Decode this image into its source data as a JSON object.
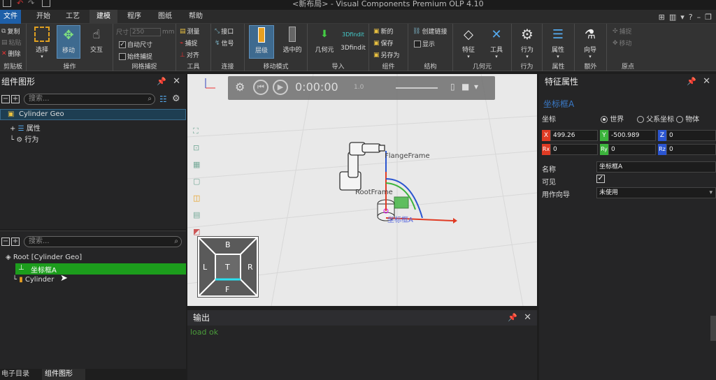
{
  "window": {
    "title": "<新布局> - Visual Components Premium OLP 4.10"
  },
  "menu": {
    "tabs": [
      {
        "label": "文件"
      },
      {
        "label": "开始"
      },
      {
        "label": "工艺"
      },
      {
        "label": "建模"
      },
      {
        "label": "程序"
      },
      {
        "label": "图纸"
      },
      {
        "label": "帮助"
      }
    ],
    "active_tab": "建模"
  },
  "ribbon": {
    "clipboard": {
      "label": "剪贴板",
      "copy": "复制",
      "paste": "粘贴",
      "delete": "删除"
    },
    "operation": {
      "label": "操作",
      "select": "选择",
      "move": "移动",
      "interact": "交互"
    },
    "grid_snap": {
      "label": "网格捕捉",
      "size_label": "尺寸",
      "size_value": "250",
      "size_unit": "mm",
      "auto_size": "自动尺寸",
      "always_snap": "始终捕捉"
    },
    "tools": {
      "label": "工具",
      "measure": "测量",
      "snap": "捕捉",
      "align": "对齐"
    },
    "connect": {
      "label": "连接",
      "interface": "接口",
      "signal": "信号"
    },
    "move_mode": {
      "label": "移动模式",
      "hierarchy": "层级",
      "selected": "选中的"
    },
    "import": {
      "label": "导入",
      "geometry": "几何元",
      "findit": "3Dfindit",
      "findit_logo": "3Dfindit"
    },
    "component": {
      "label": "组件",
      "new": "新的",
      "save": "保存",
      "save_as": "另存为"
    },
    "structure": {
      "label": "结构",
      "create_link": "创建链接",
      "show": "显示"
    },
    "geometry": {
      "label": "几何元",
      "feature": "特征",
      "tools": "工具"
    },
    "behavior": {
      "label": "行为",
      "behavior": "行为"
    },
    "properties": {
      "label": "属性",
      "properties": "属性"
    },
    "extra": {
      "label": "额外",
      "wizard": "向导"
    },
    "origin": {
      "label": "原点",
      "snap": "捕捉",
      "move": "移动"
    }
  },
  "component_graph": {
    "title": "组件图形",
    "search_placeholder": "搜索...",
    "root": "Cylinder Geo",
    "children": [
      {
        "label": "属性"
      },
      {
        "label": "行为"
      }
    ]
  },
  "feature_tree": {
    "search_placeholder": "搜索...",
    "root": "Root [Cylinder Geo]",
    "items": [
      {
        "label": "坐标框A",
        "selected": true
      },
      {
        "label": "Cylinder",
        "selected": false
      }
    ]
  },
  "viewport": {
    "time": "0:00:00",
    "speed": "1.0",
    "labels": {
      "flange": "FlangeFrame",
      "root": "RootFrame",
      "frame_a": "坐标框A"
    },
    "navcube": {
      "top": "B",
      "left": "L",
      "center": "T",
      "right": "R",
      "bottom": "F"
    }
  },
  "output": {
    "title": "输出",
    "lines": [
      "load ok"
    ]
  },
  "properties_panel": {
    "title": "特征属性",
    "subtitle": "坐标框A",
    "coord_label": "坐标",
    "coord_options": [
      {
        "label": "世界",
        "selected": true
      },
      {
        "label": "父系坐标",
        "selected": false
      },
      {
        "label": "物体",
        "selected": false
      }
    ],
    "x": "499.26",
    "y": "-500.989",
    "z": "0",
    "rx": "0",
    "ry": "0",
    "rz": "0",
    "name_label": "名称",
    "name_value": "坐标框A",
    "visible_label": "可见",
    "visible": true,
    "guide_label": "用作向导",
    "guide_value": "未使用"
  },
  "bottom_tabs": [
    {
      "label": "电子目录"
    },
    {
      "label": "组件图形",
      "active": true
    }
  ],
  "colors": {
    "accent": "#1e5fa8",
    "selected_green": "#1c9d1c",
    "x_axis": "#e03b24",
    "y_axis": "#3cb43c",
    "z_axis": "#2b55d0"
  }
}
